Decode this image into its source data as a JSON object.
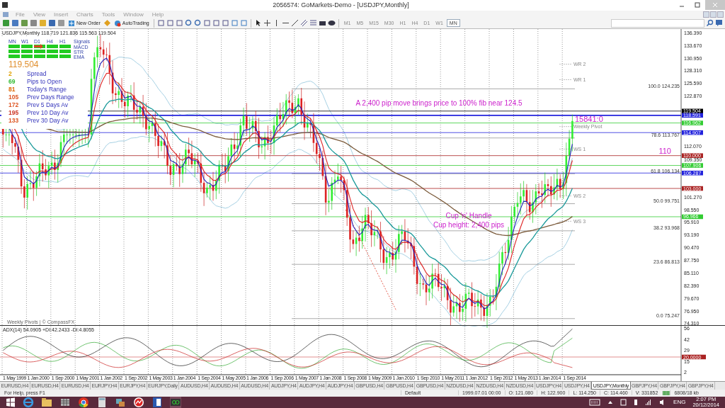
{
  "window": {
    "title": "2056574: GoMarkets-Demo - [USDJPY,Monthly]"
  },
  "menu": [
    "File",
    "View",
    "Insert",
    "Charts",
    "Tools",
    "Window",
    "Help"
  ],
  "toolbar": {
    "buttons": [
      "New Order",
      "AutoTrading"
    ],
    "timeframes": [
      {
        "label": "M1",
        "selected": false
      },
      {
        "label": "M5",
        "selected": false
      },
      {
        "label": "M15",
        "selected": false
      },
      {
        "label": "M30",
        "selected": false
      },
      {
        "label": "H1",
        "selected": false
      },
      {
        "label": "H4",
        "selected": false
      },
      {
        "label": "D1",
        "selected": false
      },
      {
        "label": "W1",
        "selected": false
      },
      {
        "label": "MN",
        "selected": true
      }
    ]
  },
  "chart": {
    "header": "USDJPY,Monthly  118.719 121.836 115.563 119.504",
    "signals": {
      "title": "Signals",
      "columns": [
        "MN",
        "W1",
        "D1",
        "H4",
        "H1"
      ],
      "rows": [
        "MACD",
        "STR",
        "EMA"
      ]
    },
    "price": "119.504",
    "stats": [
      {
        "value": "2",
        "label": "Spread",
        "color": "#e0a000"
      },
      {
        "value": "69",
        "label": "Pips to Open",
        "color": "#33bb33"
      },
      {
        "value": "81",
        "label": "Today's Range",
        "color": "#dd6600"
      },
      {
        "value": "105",
        "label": "Prev Days Range",
        "color": "#dd5522"
      },
      {
        "value": "172",
        "label": "Prev 5 Days Av",
        "color": "#dd5522"
      },
      {
        "value": "195",
        "label": "Prev 10 Day Av",
        "color": "#cc3322"
      },
      {
        "value": "133",
        "label": "Prev 30 Day Av",
        "color": "#dd5522"
      }
    ],
    "annotations": [
      "A 2,400 pip move brings price to 100% fib near 124.5",
      "15841:0",
      "110",
      "Cup 'n' Handle",
      "Cup height: 2,400 pips"
    ],
    "fib_levels": [
      "100.0 124.235",
      "78.6 113.767",
      "61.8 106.134",
      "50.0 99.751",
      "38.2 93.968",
      "23.6 86.813",
      "0.0 75.247"
    ],
    "pivots": [
      "WR 2",
      "WR 1",
      "Weekly Pivot",
      "WS 1",
      "WS 2",
      "WS 3"
    ],
    "price_ticks": [
      "136.390",
      "133.670",
      "130.950",
      "128.310",
      "125.590",
      "122.870",
      "112.070",
      "109.350",
      "101.270",
      "98.550",
      "95.910",
      "93.190",
      "90.470",
      "87.750",
      "85.110",
      "82.390",
      "79.670",
      "76.950",
      "74.310"
    ],
    "price_levels": [
      {
        "label": "119.504",
        "color": "#000000"
      },
      {
        "label": "118.591",
        "color": "#2222dd"
      },
      {
        "label": "116.962",
        "color": "#33cc33"
      },
      {
        "label": "114.907",
        "color": "#2222dd"
      },
      {
        "label": "110.000",
        "color": "#aa2222"
      },
      {
        "label": "107.906",
        "color": "#33cc33"
      },
      {
        "label": "106.287",
        "color": "#2222dd"
      },
      {
        "label": "103.000",
        "color": "#aa2222"
      },
      {
        "label": "96.966",
        "color": "#33cc33"
      }
    ],
    "footer": "Weekly Pivots | © CompassFX",
    "indicator": {
      "label": "ADX(14) 54.0905 +DI:42.2433 -DI:4.8055",
      "ticks": [
        "56",
        "42",
        "29",
        "15",
        "2"
      ],
      "level": "20.0000"
    },
    "time_labels": [
      "1 May 1999",
      "1 Jan 2000",
      "1 Sep 2000",
      "1 May 2001",
      "1 Jan 2002",
      "1 Sep 2002",
      "1 May 2003",
      "1 Jan 2004",
      "1 Sep 2004",
      "1 May 2005",
      "1 Jan 2006",
      "1 Sep 2006",
      "1 May 2007",
      "1 Jan 2008",
      "1 Sep 2008",
      "1 May 2009",
      "1 Jan 2010",
      "1 Sep 2010",
      "1 May 2011",
      "1 Jan 2012",
      "1 Sep 2012",
      "1 May 2013",
      "1 Jan 2014",
      "1 Sep 2014"
    ]
  },
  "tabs": [
    {
      "label": "EURUSD,H4",
      "selected": false
    },
    {
      "label": "EURUSD,H4",
      "selected": false
    },
    {
      "label": "EURUSD,H4",
      "selected": false
    },
    {
      "label": "EURJPY,H4",
      "selected": false
    },
    {
      "label": "EURJPY,H4",
      "selected": false
    },
    {
      "label": "EURJPY,Daily",
      "selected": false
    },
    {
      "label": "AUDUSD,H4",
      "selected": false
    },
    {
      "label": "AUDUSD,H4",
      "selected": false
    },
    {
      "label": "AUDUSD,H4",
      "selected": false
    },
    {
      "label": "AUDJPY,H4",
      "selected": false
    },
    {
      "label": "AUDJPY,H4",
      "selected": false
    },
    {
      "label": "AUDJPY,H4",
      "selected": false
    },
    {
      "label": "GBPUSD,H4",
      "selected": false
    },
    {
      "label": "GBPUSD,H4",
      "selected": false
    },
    {
      "label": "GBPUSD,H4",
      "selected": false
    },
    {
      "label": "NZDUSD,H4",
      "selected": false
    },
    {
      "label": "NZDUSD,H4",
      "selected": false
    },
    {
      "label": "NZDUSD,H4",
      "selected": false
    },
    {
      "label": "USDJPY,H4",
      "selected": false
    },
    {
      "label": "USDJPY,H4",
      "selected": false
    },
    {
      "label": "USDJPY,Monthly",
      "selected": true
    },
    {
      "label": "GBPJPY,H4",
      "selected": false
    },
    {
      "label": "GBPJPY,H4",
      "selected": false
    },
    {
      "label": "GBPJPY,H4",
      "selected": false
    }
  ],
  "status_bar": {
    "help": "For Help, press F1",
    "profile": "Default",
    "date": "1999.07.01 00:00",
    "open": "O: 121.080",
    "high": "H: 122.900",
    "low": "L: 114.250",
    "close": "C: 114.460",
    "volume": "V: 331852",
    "traffic": "6808/18 kb"
  },
  "taskbar": {
    "language": "ENG",
    "time": "2:07 PM",
    "date": "20/12/2014"
  }
}
